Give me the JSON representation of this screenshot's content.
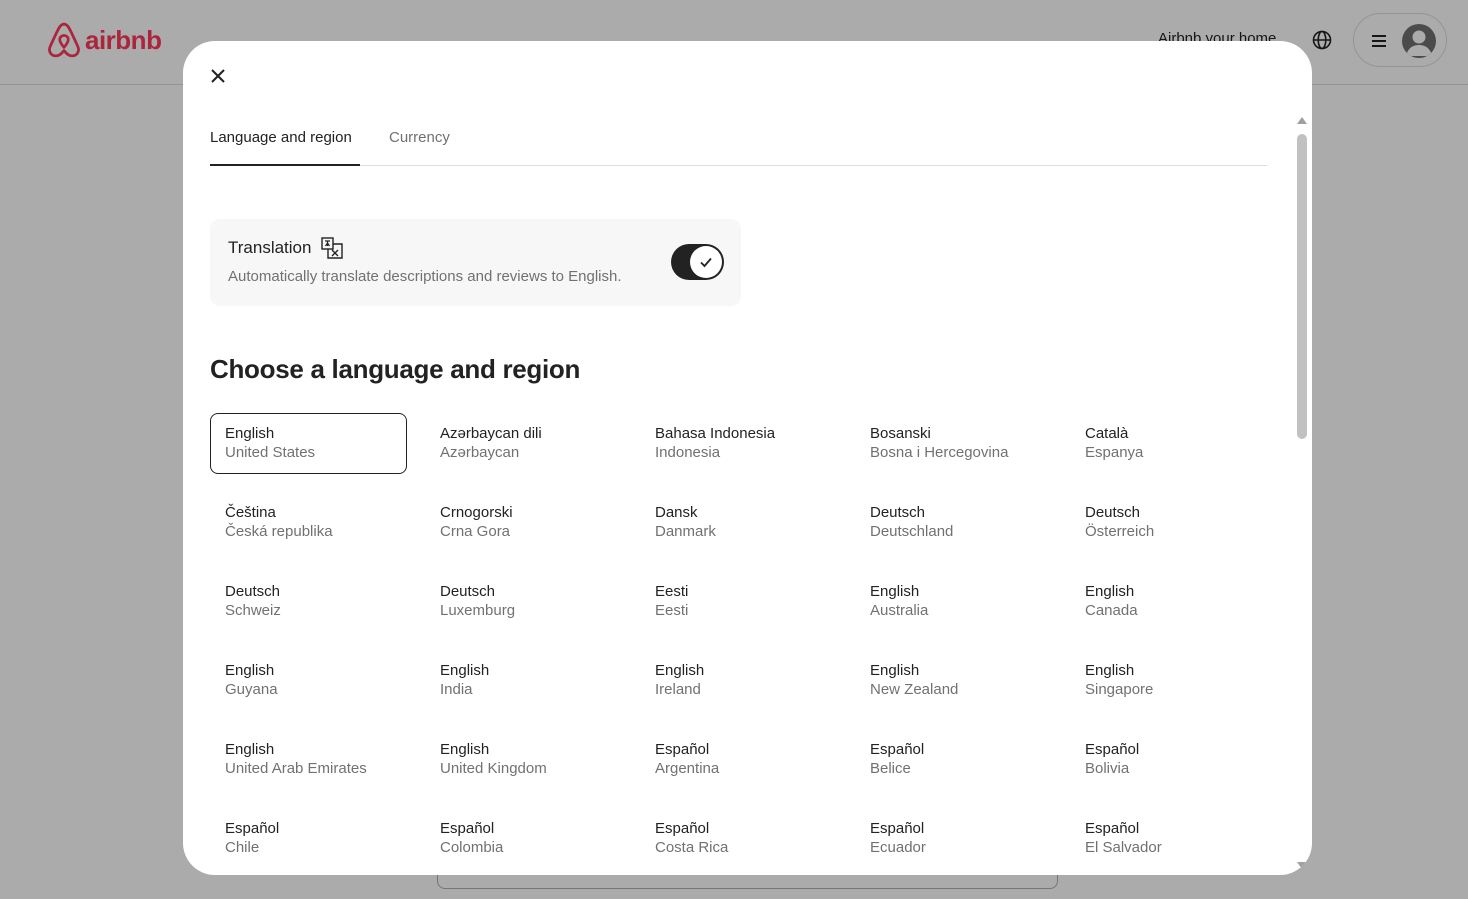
{
  "header": {
    "brand": "airbnb",
    "host_link": "Airbnb your home",
    "accent_color": "#ff385c"
  },
  "modal": {
    "tabs": [
      {
        "label": "Language and region",
        "active": true
      },
      {
        "label": "Currency",
        "active": false
      }
    ],
    "translation": {
      "title": "Translation",
      "description": "Automatically translate descriptions and reviews to English.",
      "enabled": true
    },
    "heading": "Choose a language and region",
    "languages": [
      {
        "name": "English",
        "region": "United States",
        "selected": true
      },
      {
        "name": "Azərbaycan dili",
        "region": "Azərbaycan"
      },
      {
        "name": "Bahasa Indonesia",
        "region": "Indonesia"
      },
      {
        "name": "Bosanski",
        "region": "Bosna i Hercegovina"
      },
      {
        "name": "Català",
        "region": "Espanya"
      },
      {
        "name": "Čeština",
        "region": "Česká republika"
      },
      {
        "name": "Crnogorski",
        "region": "Crna Gora"
      },
      {
        "name": "Dansk",
        "region": "Danmark"
      },
      {
        "name": "Deutsch",
        "region": "Deutschland"
      },
      {
        "name": "Deutsch",
        "region": "Österreich"
      },
      {
        "name": "Deutsch",
        "region": "Schweiz"
      },
      {
        "name": "Deutsch",
        "region": "Luxemburg"
      },
      {
        "name": "Eesti",
        "region": "Eesti"
      },
      {
        "name": "English",
        "region": "Australia"
      },
      {
        "name": "English",
        "region": "Canada"
      },
      {
        "name": "English",
        "region": "Guyana"
      },
      {
        "name": "English",
        "region": "India"
      },
      {
        "name": "English",
        "region": "Ireland"
      },
      {
        "name": "English",
        "region": "New Zealand"
      },
      {
        "name": "English",
        "region": "Singapore"
      },
      {
        "name": "English",
        "region": "United Arab Emirates"
      },
      {
        "name": "English",
        "region": "United Kingdom"
      },
      {
        "name": "Español",
        "region": "Argentina"
      },
      {
        "name": "Español",
        "region": "Belice"
      },
      {
        "name": "Español",
        "region": "Bolivia"
      },
      {
        "name": "Español",
        "region": "Chile"
      },
      {
        "name": "Español",
        "region": "Colombia"
      },
      {
        "name": "Español",
        "region": "Costa Rica"
      },
      {
        "name": "Español",
        "region": "Ecuador"
      },
      {
        "name": "Español",
        "region": "El Salvador"
      }
    ]
  },
  "icons": {
    "logo": "airbnb-logo-icon",
    "globe": "globe-icon",
    "menu": "hamburger-menu-icon",
    "avatar": "user-avatar-icon",
    "close": "close-icon",
    "translate": "translate-icon",
    "check": "check-icon"
  }
}
